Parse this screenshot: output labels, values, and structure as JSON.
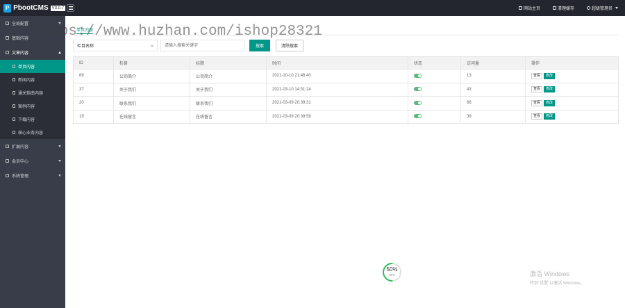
{
  "app": {
    "name": "PbootCMS",
    "version": "V3.0.7"
  },
  "topbar": {
    "links": [
      {
        "label": "网站主页",
        "icon": "home-icon"
      },
      {
        "label": "清理缓存",
        "icon": "trash-icon"
      },
      {
        "label": "超级管理员",
        "icon": "user-icon"
      }
    ]
  },
  "sidebar": {
    "items": [
      {
        "label": "全局配置",
        "icon": "gear-icon"
      },
      {
        "label": "基础内容",
        "icon": "sliders-icon"
      },
      {
        "label": "文章内容",
        "icon": "document-icon"
      }
    ],
    "sub_items": [
      {
        "label": "单页内容"
      },
      {
        "label": "新闻内容"
      },
      {
        "label": "通关指南内容"
      },
      {
        "label": "案例内容"
      },
      {
        "label": "下载内容"
      },
      {
        "label": "核心业务内容"
      }
    ],
    "after_items": [
      {
        "label": "扩展内容",
        "icon": "puzzle-icon"
      },
      {
        "label": "会员中心",
        "icon": "lock-icon"
      },
      {
        "label": "系统管理",
        "icon": "gear-icon"
      }
    ]
  },
  "main": {
    "tab_title": "单页内容",
    "filter": {
      "select_value": "栏目名称",
      "search_placeholder": "请输入搜索关键字",
      "search_button": "搜索",
      "clear_button": "清除搜索"
    },
    "table": {
      "headers": [
        "ID",
        "栏目",
        "标题",
        "时间",
        "状态",
        "访问量",
        "操作"
      ],
      "rows": [
        {
          "id": "69",
          "column": "公司简介",
          "title": "公司简介",
          "time": "2021-10-10 21:46:40",
          "views": "13"
        },
        {
          "id": "37",
          "column": "关于我们",
          "title": "关于我们",
          "time": "2021-03-10 14:31:24",
          "views": "43"
        },
        {
          "id": "20",
          "column": "联系我们",
          "title": "联系我们",
          "time": "2021-03-09 20:39:31",
          "views": "66"
        },
        {
          "id": "19",
          "column": "在线留言",
          "title": "在线留言",
          "time": "2021-03-09 20:38:58",
          "views": "39"
        }
      ],
      "op_view": "查看",
      "op_edit": "修改"
    }
  },
  "progress": {
    "value": 50,
    "text": "50%",
    "sub": "39°C"
  },
  "watermark": "https://www.huzhan.com/ishop28321",
  "activate": {
    "line1": "激活 Windows",
    "line2": "转到\"设置\"以激活 Windows。"
  }
}
